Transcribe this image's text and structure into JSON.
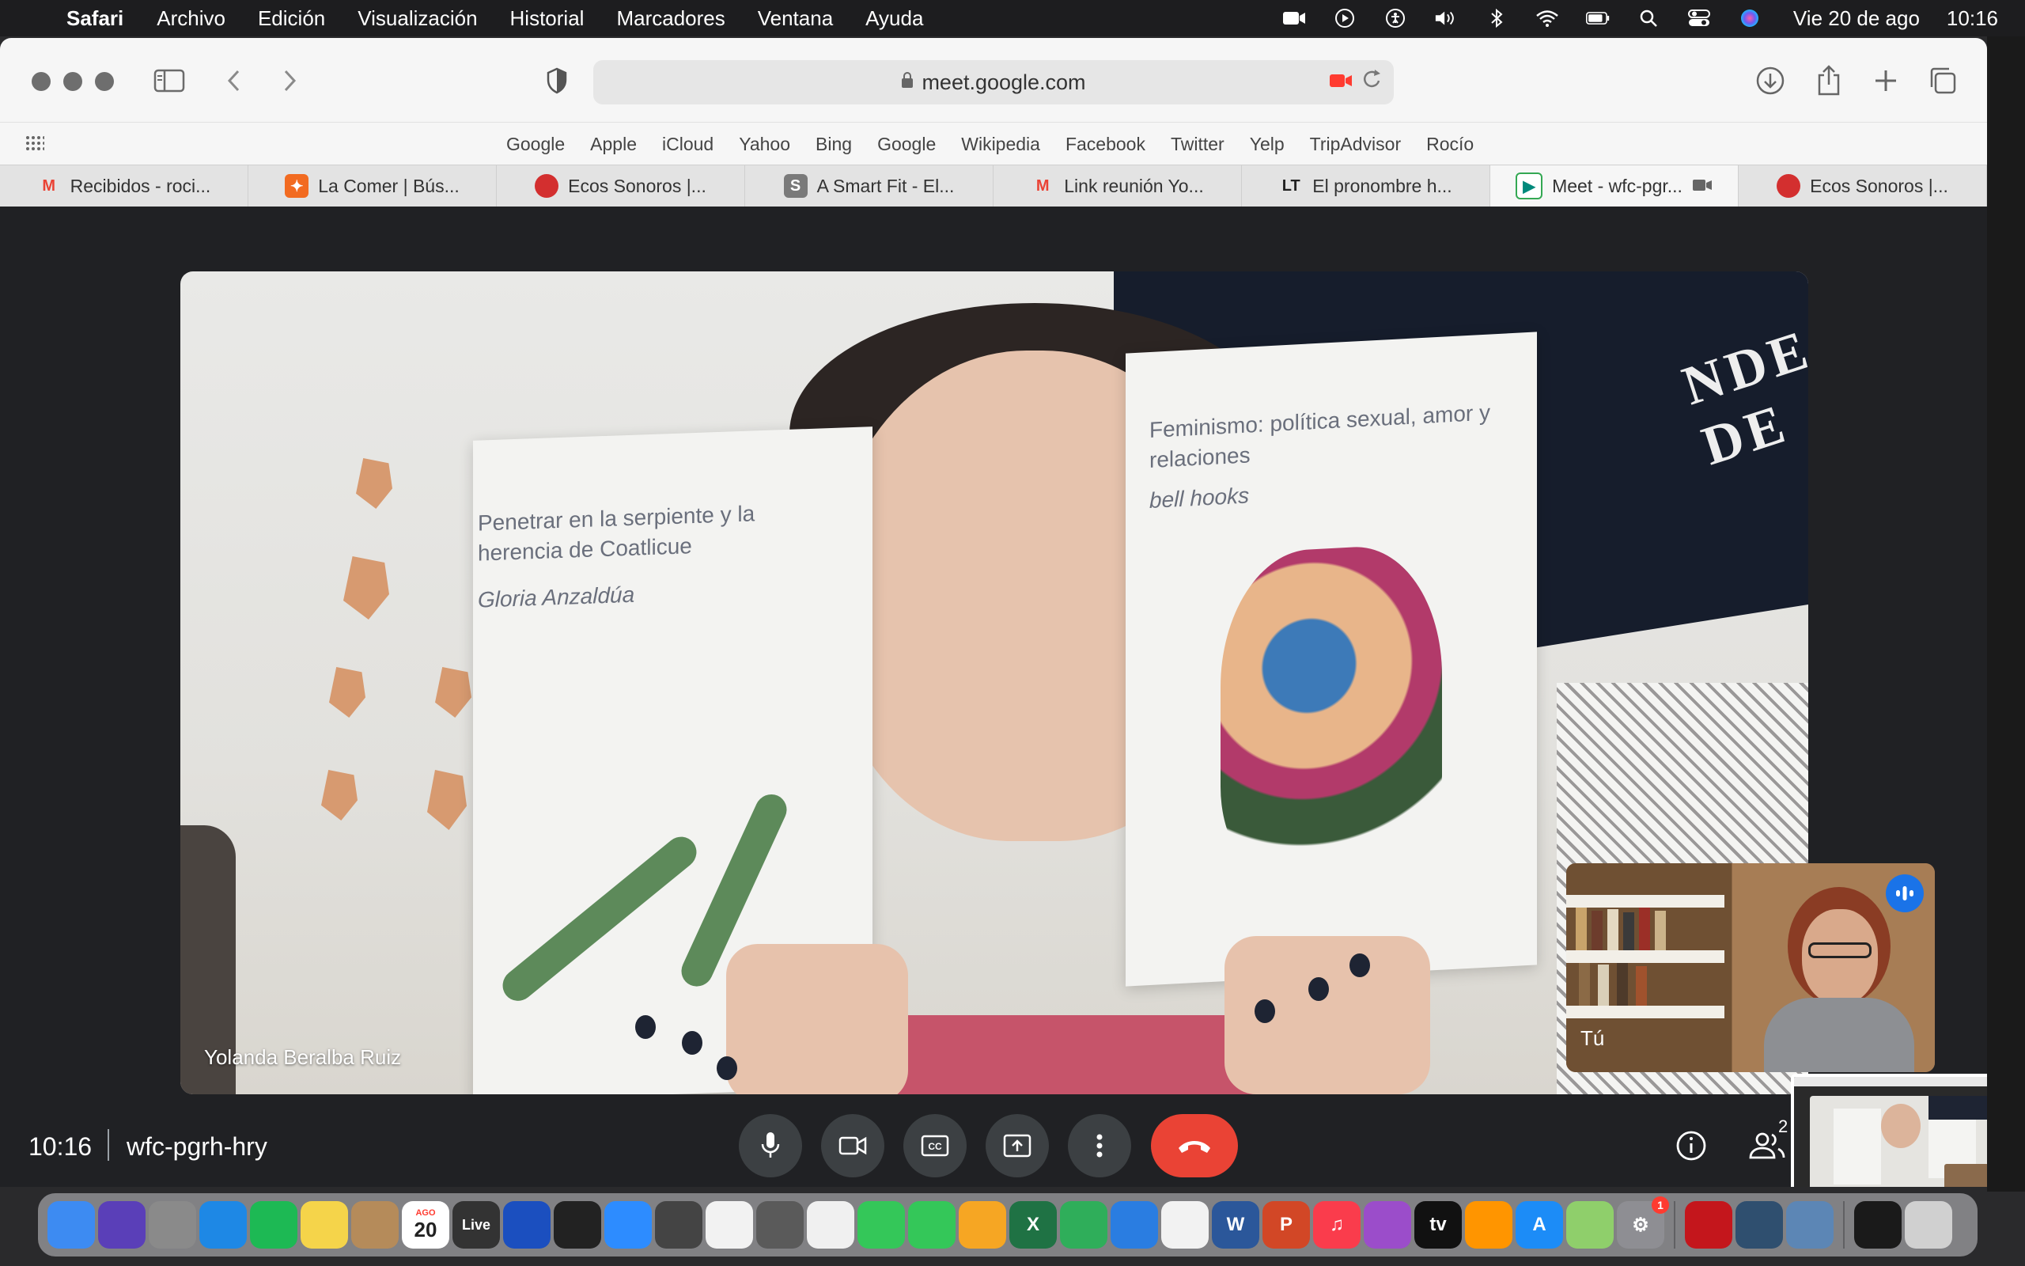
{
  "menubar": {
    "app": "Safari",
    "menus": [
      "Archivo",
      "Edición",
      "Visualización",
      "Historial",
      "Marcadores",
      "Ventana",
      "Ayuda"
    ],
    "status_icons": [
      "screen-record-icon",
      "play-icon",
      "accessibility-icon",
      "volume-icon",
      "bluetooth-icon",
      "wifi-icon",
      "battery-icon",
      "spotlight-icon",
      "control-center-icon",
      "siri-icon"
    ],
    "date": "Vie 20 de ago",
    "time": "10:16"
  },
  "browser": {
    "url": "meet.google.com",
    "favorites": [
      "Google",
      "Apple",
      "iCloud",
      "Yahoo",
      "Bing",
      "Google",
      "Wikipedia",
      "Facebook",
      "Twitter",
      "Yelp",
      "TripAdvisor",
      "Rocío"
    ],
    "tabs": [
      {
        "label": "Recibidos - roci...",
        "icon": "gmail-icon",
        "color": "#ea4335",
        "glyph": "M"
      },
      {
        "label": "La Comer | Bús...",
        "icon": "lacomer-icon",
        "color": "#f26b21",
        "glyph": "✦"
      },
      {
        "label": "Ecos Sonoros |...",
        "icon": "ecos-icon",
        "color": "#d32f2f",
        "glyph": ""
      },
      {
        "label": "A Smart Fit - El...",
        "icon": "scribd-icon",
        "color": "#7a7a7a",
        "glyph": "S"
      },
      {
        "label": "Link reunión Yo...",
        "icon": "gmail-icon",
        "color": "#ea4335",
        "glyph": "M"
      },
      {
        "label": "El pronombre h...",
        "icon": "lt-icon",
        "color": "#222222",
        "glyph": "LT"
      },
      {
        "label": "Meet - wfc-pgr...",
        "icon": "meet-icon",
        "color": "#00897b",
        "glyph": "▶",
        "active": true
      },
      {
        "label": "Ecos Sonoros |...",
        "icon": "ecos-icon",
        "color": "#d32f2f",
        "glyph": ""
      }
    ]
  },
  "meet": {
    "participant_name": "Yolanda Beralba Ruiz",
    "self_label": "Tú",
    "meeting_time": "10:16",
    "meeting_code": "wfc-pgrh-hry",
    "people_count": "2",
    "book_left": {
      "title": "Penetrar en la serpiente y la herencia de Coatlicue",
      "author": "Gloria Anzaldúa"
    },
    "book_right": {
      "title": "Feminismo: política sexual, amor y relaciones",
      "author": "bell hooks"
    },
    "banner_text": "NDE DE",
    "colors": {
      "hangup": "#ea4335",
      "control_bg": "#3c4043",
      "bg": "#202124",
      "speaking": "#1a73e8"
    }
  },
  "dock": {
    "apps": [
      {
        "name": "finder-icon",
        "color": "#3d8bf2",
        "glyph": ""
      },
      {
        "name": "siri-icon",
        "color": "#5a3fb8",
        "glyph": ""
      },
      {
        "name": "launchpad-icon",
        "color": "#8a8a8a",
        "glyph": ""
      },
      {
        "name": "safari-icon",
        "color": "#1e88e5",
        "glyph": ""
      },
      {
        "name": "spotify-icon",
        "color": "#1db954",
        "glyph": ""
      },
      {
        "name": "notes-icon",
        "color": "#f5d44a",
        "glyph": ""
      },
      {
        "name": "contacts-icon",
        "color": "#b58b5a",
        "glyph": ""
      },
      {
        "name": "calendar-icon",
        "color": "#ffffff",
        "glyph": "20",
        "sub": "AGO"
      },
      {
        "name": "ableton-live-icon",
        "color": "#333333",
        "glyph": "Live"
      },
      {
        "name": "audacity-icon",
        "color": "#1b4fbf",
        "glyph": ""
      },
      {
        "name": "piano-icon",
        "color": "#222222",
        "glyph": ""
      },
      {
        "name": "zoom-icon",
        "color": "#2d8cff",
        "glyph": ""
      },
      {
        "name": "calculator-icon",
        "color": "#444444",
        "glyph": ""
      },
      {
        "name": "reminders-icon",
        "color": "#f2f2f2",
        "glyph": ""
      },
      {
        "name": "photo-booth-icon",
        "color": "#5a5a5a",
        "glyph": ""
      },
      {
        "name": "photos-icon",
        "color": "#f0f0f0",
        "glyph": ""
      },
      {
        "name": "messages-icon",
        "color": "#34c759",
        "glyph": ""
      },
      {
        "name": "facetime-icon",
        "color": "#34c759",
        "glyph": ""
      },
      {
        "name": "pages-icon",
        "color": "#f6a623",
        "glyph": ""
      },
      {
        "name": "excel-icon",
        "color": "#1f7244",
        "glyph": "X"
      },
      {
        "name": "numbers-icon",
        "color": "#2fae5a",
        "glyph": ""
      },
      {
        "name": "keynote-icon",
        "color": "#2a7de1",
        "glyph": ""
      },
      {
        "name": "chrome-icon",
        "color": "#f2f2f2",
        "glyph": ""
      },
      {
        "name": "word-icon",
        "color": "#2b579a",
        "glyph": "W"
      },
      {
        "name": "powerpoint-icon",
        "color": "#d24726",
        "glyph": "P"
      },
      {
        "name": "music-icon",
        "color": "#fa3c4c",
        "glyph": "♫"
      },
      {
        "name": "podcasts-icon",
        "color": "#9b4dca",
        "glyph": ""
      },
      {
        "name": "apple-tv-icon",
        "color": "#111111",
        "glyph": "tv"
      },
      {
        "name": "books-icon",
        "color": "#ff9500",
        "glyph": ""
      },
      {
        "name": "app-store-icon",
        "color": "#1c8cf7",
        "glyph": "A"
      },
      {
        "name": "maps-icon",
        "color": "#8fcf6b",
        "glyph": ""
      },
      {
        "name": "system-preferences-icon",
        "color": "#8e8e93",
        "glyph": "⚙",
        "badge": "1"
      },
      {
        "name": "acrobat-icon",
        "color": "#c4161c",
        "glyph": ""
      },
      {
        "name": "quicktime-icon",
        "color": "#2f4f6f",
        "glyph": ""
      },
      {
        "name": "preview-icon",
        "color": "#5c86b5",
        "glyph": ""
      },
      {
        "name": "screen-icon",
        "color": "#1a1a1a",
        "glyph": ""
      },
      {
        "name": "trash-icon",
        "color": "#d0d0d0",
        "glyph": ""
      }
    ]
  }
}
